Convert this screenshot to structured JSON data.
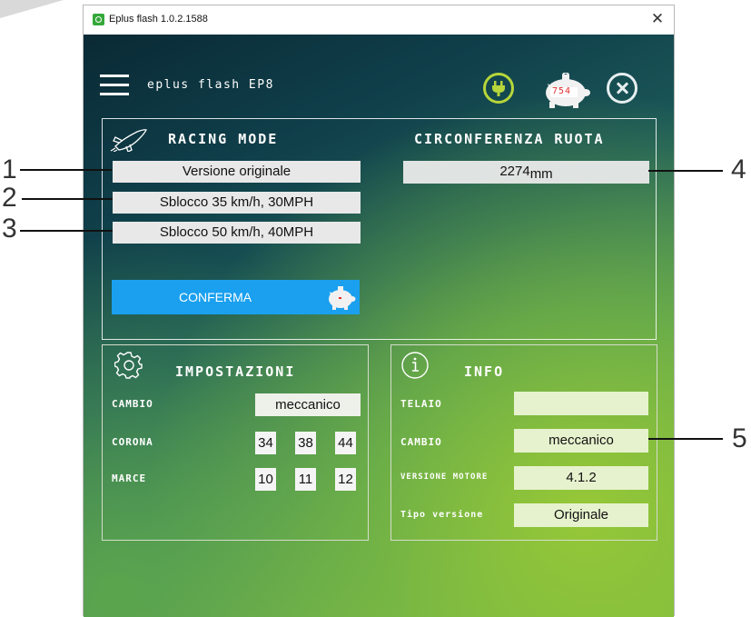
{
  "window": {
    "title": "Eplus flash 1.0.2.1588",
    "close_glyph": "✕"
  },
  "header": {
    "app_name": "eplus flash EP8",
    "piggy_counter": "754",
    "icons": [
      "menu-icon",
      "plug-icon",
      "piggy-bank-icon",
      "close-circle-icon"
    ]
  },
  "racing": {
    "heading": "RACING MODE",
    "options": [
      "Versione originale",
      "Sblocco 35 km/h, 30MPH",
      "Sblocco 50 km/h, 40MPH"
    ],
    "confirm_label": "CONFERMA",
    "circ_heading": "CIRCONFERENZA RUOTA",
    "circ_value": "2274",
    "circ_unit": "mm"
  },
  "settings": {
    "heading": "IMPOSTAZIONI",
    "cambio_label": "CAMBIO",
    "cambio_value": "meccanico",
    "corona_label": "CORONA",
    "corona_values": [
      "34",
      "38",
      "44"
    ],
    "marce_label": "MARCE",
    "marce_values": [
      "10",
      "11",
      "12"
    ]
  },
  "info": {
    "heading": "INFO",
    "telaio_label": "TELAIO",
    "telaio_value": "",
    "cambio_label": "CAMBIO",
    "cambio_value": "meccanico",
    "motore_label": "VERSIONE MOTORE",
    "motore_value": "4.1.2",
    "tipo_label": "Tipo versione",
    "tipo_value": "Originale"
  },
  "callouts": [
    "1",
    "2",
    "3",
    "4",
    "5"
  ],
  "colors": {
    "accent_blue": "#1aa0ef",
    "lime": "#b6d63a",
    "counter_red": "#e03030"
  }
}
